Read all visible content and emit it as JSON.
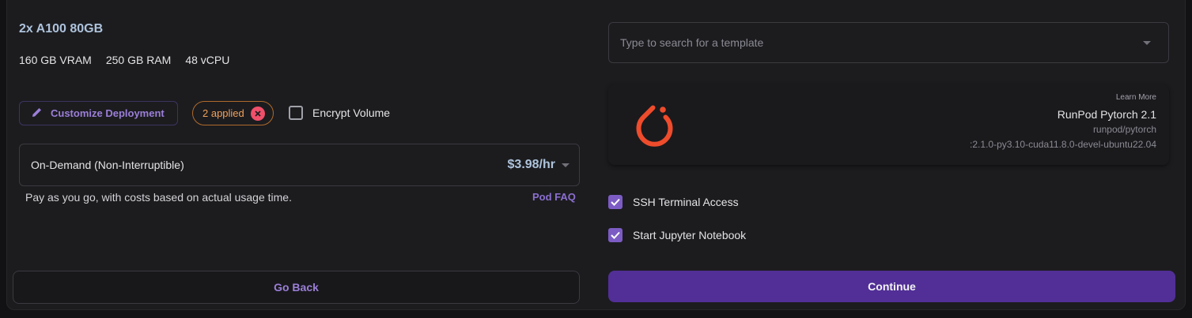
{
  "gpu": {
    "title": "2x A100 80GB",
    "vram": "160 GB VRAM",
    "ram": "250 GB RAM",
    "vcpu": "48 vCPU"
  },
  "deployment": {
    "customize_label": "Customize Deployment",
    "applied_label": "2 applied",
    "encrypt_label": "Encrypt Volume",
    "encrypt_checked": false
  },
  "pricing": {
    "selected_option": "On-Demand (Non-Interruptible)",
    "price": "$3.98/hr",
    "description": "Pay as you go, with costs based on actual usage time.",
    "faq_link": "Pod FAQ"
  },
  "template": {
    "search_placeholder": "Type to search for a template",
    "learn_more": "Learn More",
    "name": "RunPod Pytorch 2.1",
    "image": "runpod/pytorch",
    "tag": ":2.1.0-py3.10-cuda11.8.0-devel-ubuntu22.04",
    "logo_icon": "pytorch-logo"
  },
  "options": {
    "ssh_label": "SSH Terminal Access",
    "ssh_checked": true,
    "jupyter_label": "Start Jupyter Notebook",
    "jupyter_checked": true
  },
  "actions": {
    "back_label": "Go Back",
    "continue_label": "Continue"
  },
  "colors": {
    "accent": "#512f96",
    "accent_text": "#9b7fd8",
    "warning": "#f0a15a",
    "pytorch": "#ee4c2c"
  }
}
